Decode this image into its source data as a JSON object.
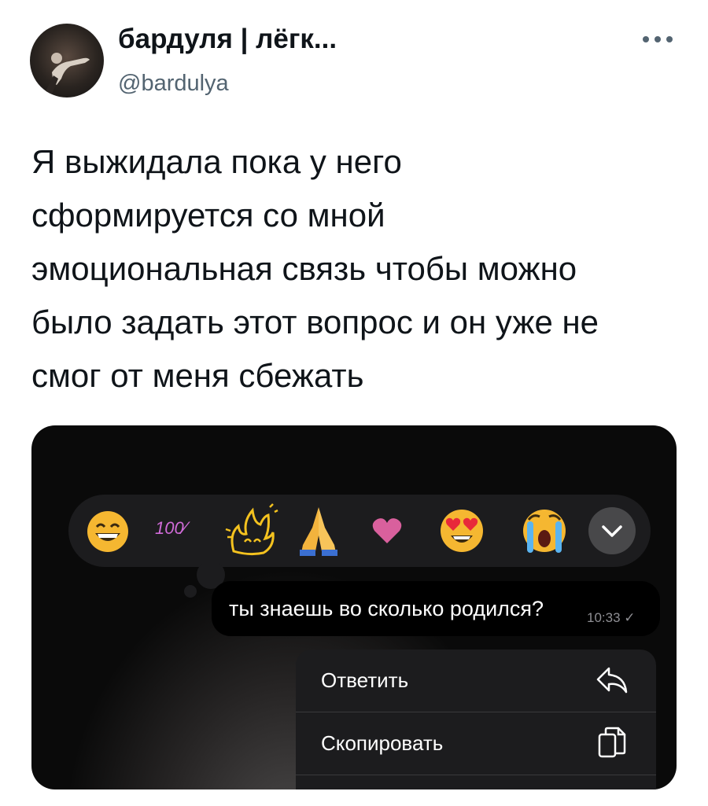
{
  "tweet": {
    "author_name": "бардуля | лёгк...",
    "author_handle": "@bardulya",
    "lines": [
      "Я выжидала пока у него",
      "сформируется со мной",
      "эмоциональная связь чтобы можно",
      "было задать этот вопрос и он уже не",
      "смог от меня сбежать"
    ]
  },
  "screenshot": {
    "reactions": [
      "grin-emoji-icon",
      "hundred-percent-icon",
      "fire-sketch-icon",
      "praying-hands-icon",
      "heart-icon",
      "heart-eyes-emoji-icon",
      "crying-emoji-icon",
      "expand-chevron-icon"
    ],
    "reaction_100_text": "100⁄",
    "message": {
      "text": "ты знаешь во сколько родился?",
      "time": "10:33",
      "status": "✓"
    },
    "menu": {
      "reply_label": "Ответить",
      "copy_label": "Скопировать"
    }
  }
}
